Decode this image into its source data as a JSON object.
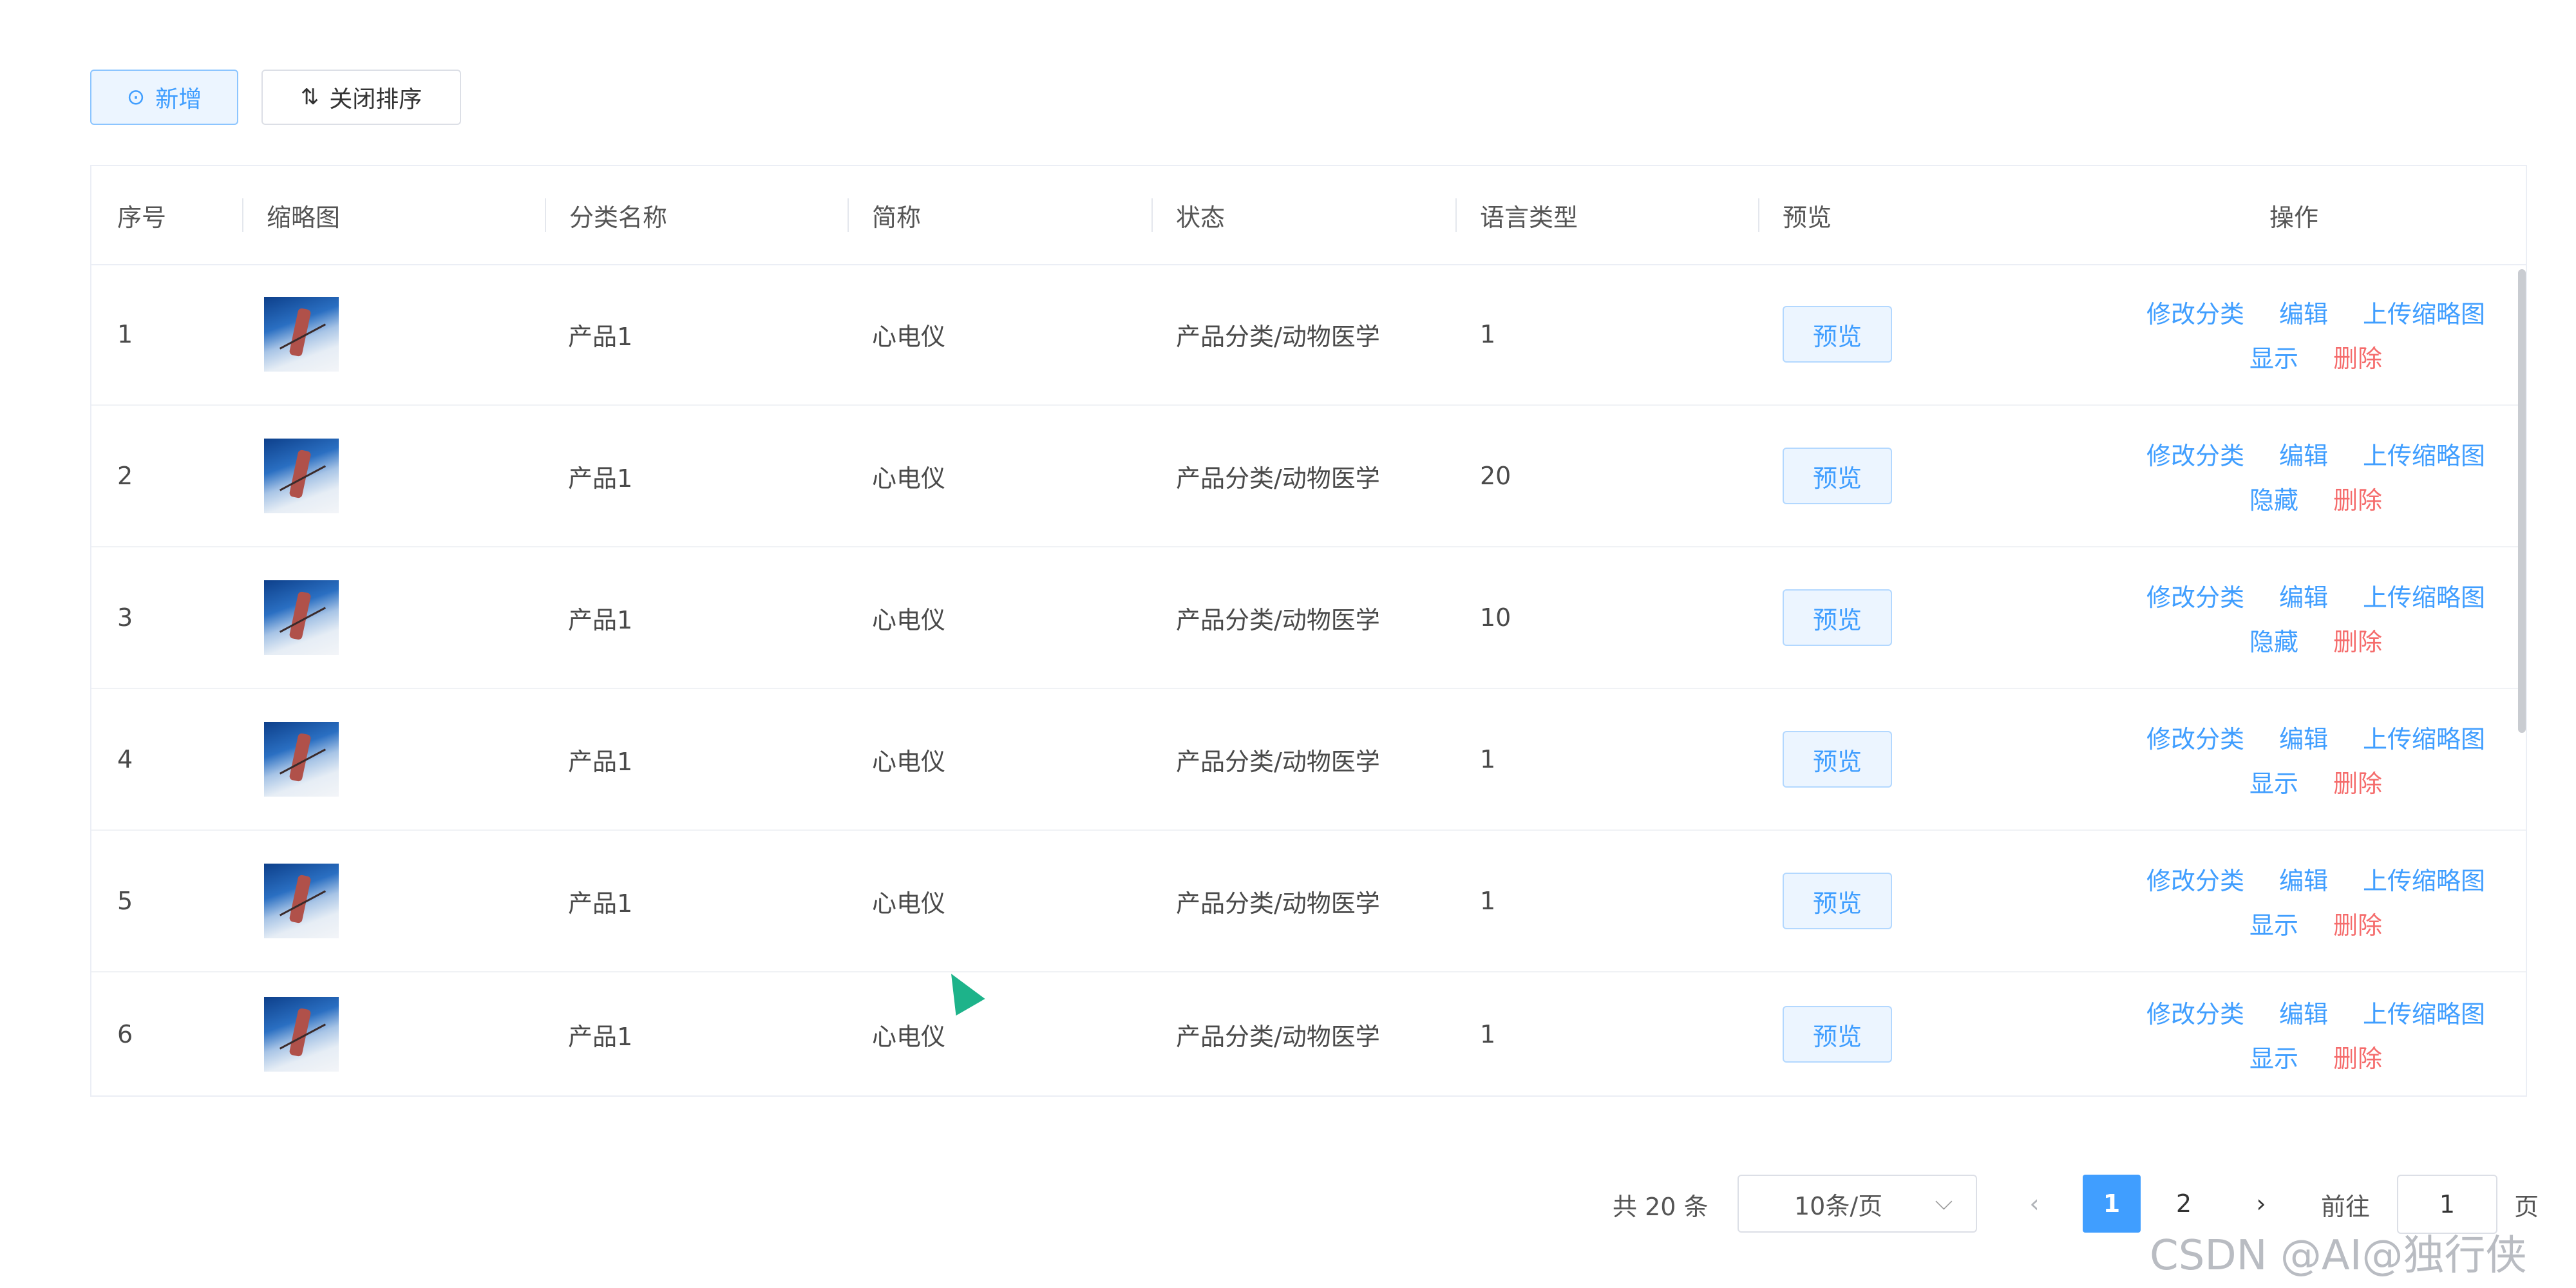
{
  "toolbar": {
    "add_icon": "plus-circle-icon",
    "add_label": "新增",
    "sort_icon": "sort-icon",
    "sort_label": "关闭排序"
  },
  "table": {
    "headers": [
      "序号",
      "缩略图",
      "分类名称",
      "简称",
      "状态",
      "语言类型",
      "预览",
      "操作"
    ],
    "rows": [
      {
        "index": "1",
        "category": "产品1",
        "short": "心电仪",
        "status": "产品分类/动物医学",
        "lang": "1",
        "visibility": "显示"
      },
      {
        "index": "2",
        "category": "产品1",
        "short": "心电仪",
        "status": "产品分类/动物医学",
        "lang": "20",
        "visibility": "隐藏"
      },
      {
        "index": "3",
        "category": "产品1",
        "short": "心电仪",
        "status": "产品分类/动物医学",
        "lang": "10",
        "visibility": "隐藏"
      },
      {
        "index": "4",
        "category": "产品1",
        "short": "心电仪",
        "status": "产品分类/动物医学",
        "lang": "1",
        "visibility": "显示"
      },
      {
        "index": "5",
        "category": "产品1",
        "short": "心电仪",
        "status": "产品分类/动物医学",
        "lang": "1",
        "visibility": "显示"
      },
      {
        "index": "6",
        "category": "产品1",
        "short": "心电仪",
        "status": "产品分类/动物医学",
        "lang": "1",
        "visibility": "显示"
      }
    ],
    "preview_label": "预览",
    "op_edit_category": "修改分类",
    "op_edit": "编辑",
    "op_upload_thumb": "上传缩略图",
    "op_delete": "删除"
  },
  "pagination": {
    "total_label": "共 20 条",
    "page_size": "10条/页",
    "prev_icon": "chevron-left-icon",
    "next_icon": "chevron-right-icon",
    "pages": [
      "1",
      "2"
    ],
    "current_page": "1",
    "goto_label": "前往",
    "goto_value": "1",
    "page_suffix": "页"
  },
  "watermark": "CSDN @AI@独行侠",
  "colors": {
    "primary": "#409eff",
    "danger": "#f56c6c"
  }
}
